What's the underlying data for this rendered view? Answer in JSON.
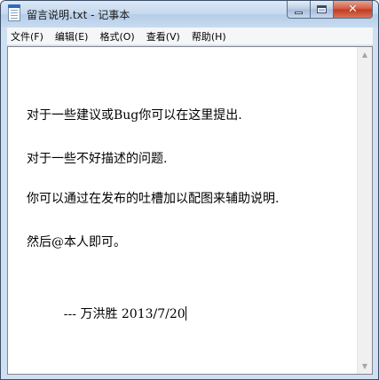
{
  "window": {
    "title": "留言说明.txt - 记事本",
    "controls": {
      "minimize": "minimize",
      "maximize": "maximize",
      "close": "✕"
    }
  },
  "menu": {
    "items": [
      {
        "label": "文件(F)"
      },
      {
        "label": "编辑(E)"
      },
      {
        "label": "格式(O)"
      },
      {
        "label": "查看(V)"
      },
      {
        "label": "帮助(H)"
      }
    ]
  },
  "document": {
    "lines": [
      "对于一些建议或Bug你可以在这里提出.",
      "对于一些不好描述的问题.",
      "你可以通过在发布的吐槽加以配图来辅助说明.",
      "然后@本人即可。",
      "    --- 万洪胜 2013/7/20"
    ]
  },
  "scrollbar": {
    "up_arrow": "▲",
    "down_arrow": "▼"
  },
  "icons": {
    "app": "notepad-icon"
  },
  "colors": {
    "titlebar": "#c4d8ee",
    "close_button": "#c13a1d",
    "menubar": "#f5f6f7",
    "text": "#000000"
  }
}
